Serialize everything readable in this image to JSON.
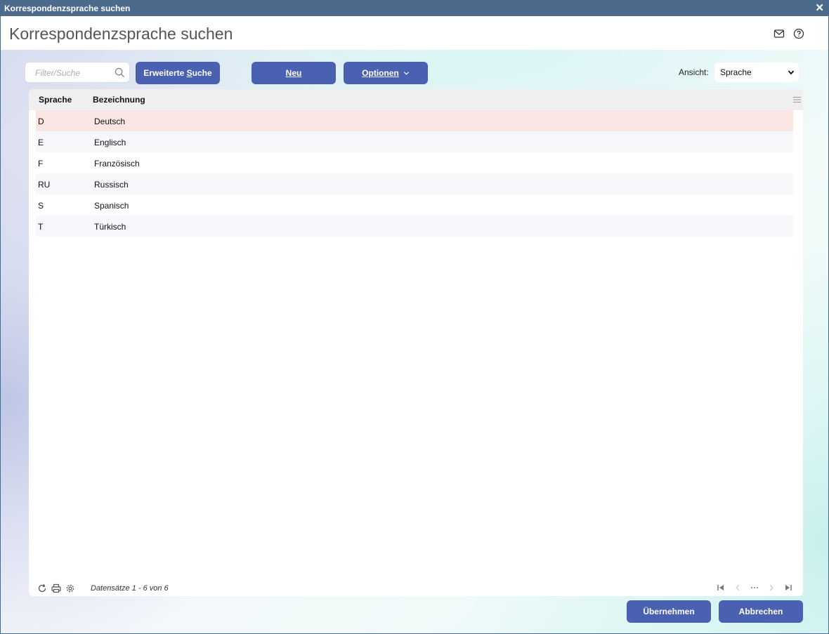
{
  "window": {
    "title": "Korrespondenzsprache suchen"
  },
  "header": {
    "title": "Korrespondenzsprache suchen"
  },
  "toolbar": {
    "search_placeholder": "Filter/Suche",
    "advanced_search_prefix": "Erweiterte ",
    "advanced_search_key": "S",
    "advanced_search_rest": "uche",
    "new_label": "Neu",
    "options_label": "Optionen",
    "view_label": "Ansicht:",
    "view_value": "Sprache"
  },
  "grid": {
    "columns": [
      "Sprache",
      "Bezeichnung"
    ],
    "rows": [
      {
        "code": "D",
        "name": "Deutsch"
      },
      {
        "code": "E",
        "name": "Englisch"
      },
      {
        "code": "F",
        "name": "Französisch"
      },
      {
        "code": "RU",
        "name": "Russisch"
      },
      {
        "code": "S",
        "name": "Spanisch"
      },
      {
        "code": "T",
        "name": "Türkisch"
      }
    ],
    "record_count": "Datensätze 1 - 6 von 6"
  },
  "footer": {
    "apply_label": "Übernehmen",
    "cancel_label": "Abbrechen"
  },
  "colors": {
    "titlebar": "#4c6b8c",
    "button": "#4a60b0",
    "selected_row": "#f9e6e3"
  }
}
